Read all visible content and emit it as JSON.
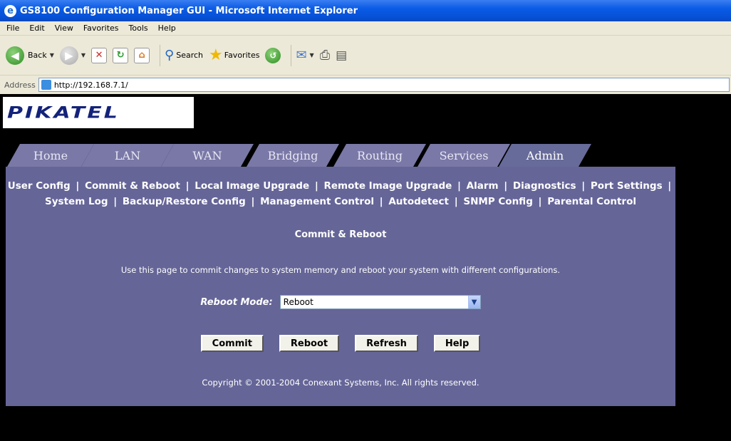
{
  "window": {
    "title": "GS8100 Configuration Manager GUI - Microsoft Internet Explorer"
  },
  "menu": [
    "File",
    "Edit",
    "View",
    "Favorites",
    "Tools",
    "Help"
  ],
  "toolbar": {
    "back": "Back",
    "search": "Search",
    "favorites": "Favorites"
  },
  "address": {
    "label": "Address",
    "url": "http://192.168.7.1/"
  },
  "logo": "PIKATEL",
  "tabs": [
    "Home",
    "LAN",
    "WAN",
    "Bridging",
    "Routing",
    "Services",
    "Admin"
  ],
  "active_tab": "Admin",
  "sublinks_row1": [
    "User Config",
    "Commit & Reboot",
    "Local Image Upgrade",
    "Remote Image Upgrade",
    "Alarm",
    "Diagnostics",
    "Port Settings"
  ],
  "sublinks_row2": [
    "System Log",
    "Backup/Restore Config",
    "Management Control",
    "Autodetect",
    "SNMP Config",
    "Parental Control"
  ],
  "page": {
    "heading": "Commit & Reboot",
    "description": "Use this page to commit changes to system memory and reboot your system with different configurations.",
    "mode_label": "Reboot Mode:",
    "mode_value": "Reboot",
    "buttons": {
      "commit": "Commit",
      "reboot": "Reboot",
      "refresh": "Refresh",
      "help": "Help"
    },
    "copyright": "Copyright © 2001-2004 Conexant Systems, Inc. All rights reserved."
  },
  "colors": {
    "panel": "#656598",
    "tab": "#7a78a6",
    "logo_text": "#13227a",
    "title_bar": "#0a5be6"
  }
}
